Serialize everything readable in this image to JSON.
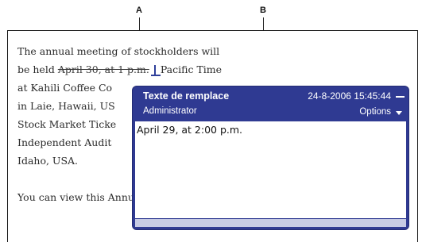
{
  "callouts": {
    "a": "A",
    "b": "B"
  },
  "document": {
    "line1": "The annual meeting of stockholders will",
    "line2_prefix": "be held",
    "line2_deleted": "April 30, at 1 p.m.",
    "line2_suffix": "Pacific Time",
    "line3": "at Kahili Coffee Co",
    "line4": "in Laie, Hawaii, US",
    "line5": "Stock Market Ticke",
    "line6": "Independent Audit",
    "line7": "Idaho, USA.",
    "line8": "You can view this Annual Report, obtain"
  },
  "note": {
    "title": "Texte de remplace",
    "timestamp": "24-8-2006 15:45:44",
    "author": "Administrator",
    "options_label": "Options",
    "body": "April 29, at 2:00 p.m."
  }
}
